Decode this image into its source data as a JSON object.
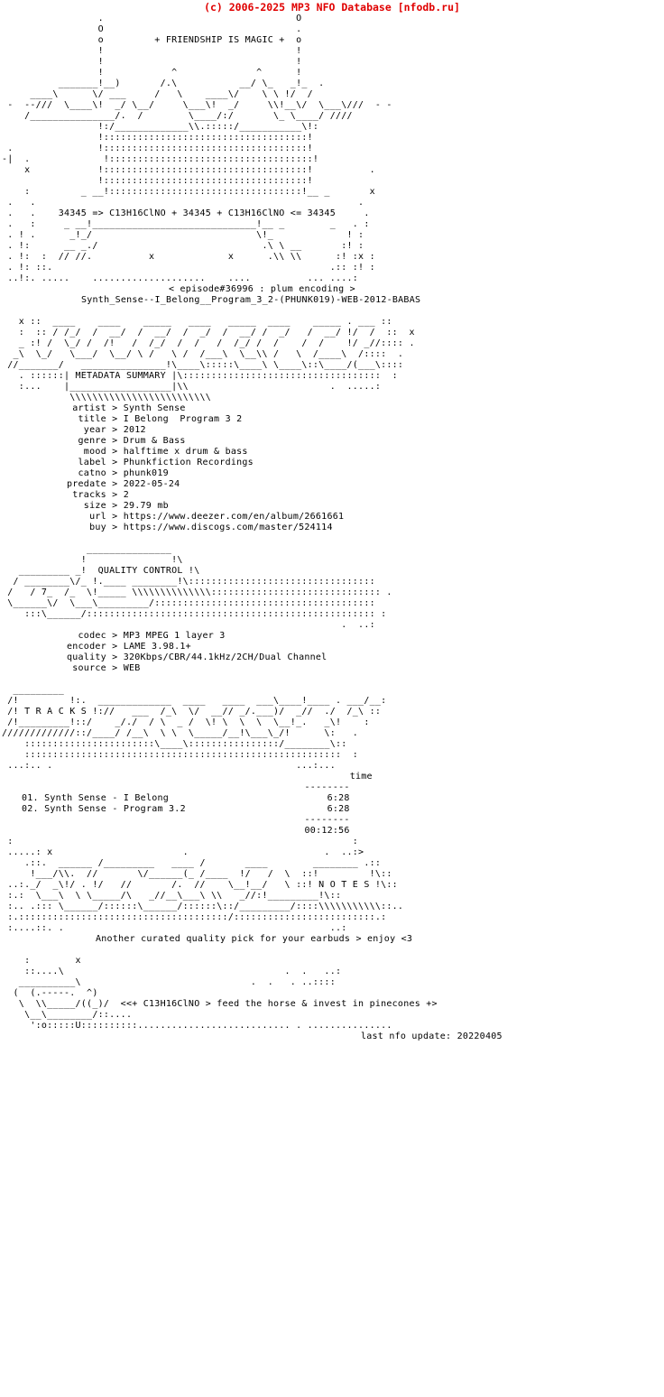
{
  "site_header": "(c) 2006-2025 MP3 NFO Database [nfodb.ru]",
  "accent_color": "#e00000",
  "text_color": "#000000",
  "background_color": "#ffffff",
  "group_tagline": "+ FRIENDSHIP IS MAGIC +",
  "chem_line": "34345 => C13H16ClNO + 34345 + C13H16ClNO <= 34345",
  "episode_line": "< episode#36996 : plum encoding >",
  "release_name": "Synth_Sense--I_Belong__Program_3_2-(PHUNK019)-WEB-2012-BABAS",
  "banners": {
    "metadata": "METADATA SUMMARY",
    "quality": "QUALITY CONTROL",
    "tracks": "T R A C K S",
    "notes": "N O T E S"
  },
  "metadata": {
    "groups": [
      [
        {
          "label": "artist",
          "sep": ">",
          "value": "Synth Sense"
        },
        {
          "label": "title",
          "sep": ">",
          "value": "I Belong  Program 3 2"
        },
        {
          "label": "year",
          "sep": ">",
          "value": "2012"
        },
        {
          "label": "genre",
          "sep": ">",
          "value": "Drum & Bass"
        },
        {
          "label": "mood",
          "sep": ">",
          "value": "halftime x drum & bass"
        }
      ],
      [
        {
          "label": "label",
          "sep": ">",
          "value": "Phunkfiction Recordings"
        },
        {
          "label": "catno",
          "sep": ">",
          "value": "phunk019"
        }
      ],
      [
        {
          "label": "predate",
          "sep": ">",
          "value": "2022-05-24"
        },
        {
          "label": "tracks",
          "sep": ">",
          "value": "2"
        },
        {
          "label": "size",
          "sep": ">",
          "value": "29.79 mb"
        }
      ],
      [
        {
          "label": "url",
          "sep": ">",
          "value": "https://www.deezer.com/en/album/2661661"
        },
        {
          "label": "buy",
          "sep": ">",
          "value": "https://www.discogs.com/master/524114"
        }
      ]
    ]
  },
  "quality": {
    "rows": [
      {
        "label": "codec",
        "sep": ">",
        "value": "MP3 MPEG 1 layer 3"
      },
      {
        "label": "encoder",
        "sep": ">",
        "value": "LAME 3.98.1+"
      },
      {
        "label": "quality",
        "sep": ">",
        "value": "320Kbps/CBR/44.1kHz/2CH/Dual Channel"
      },
      {
        "label": "source",
        "sep": ">",
        "value": "WEB"
      }
    ]
  },
  "tracklist": {
    "time_header": "time",
    "rule": "--------",
    "rows": [
      {
        "num": "01.",
        "title": "Synth Sense - I Belong",
        "time": "6:28"
      },
      {
        "num": "02.",
        "title": "Synth Sense - Program 3.2",
        "time": "6:28"
      }
    ],
    "total": "00:12:56"
  },
  "notes": {
    "text": "Another curated quality pick for your earbuds > enjoy <3"
  },
  "footer": {
    "horse_line": "<<+ C13H16ClNO > feed the horse & invest in pinecones +>",
    "last_update": "last nfo update: 20220405"
  },
  "art": {
    "top_banner": "                 .                                  O\n                 O                                  .\n                 o         + FRIENDSHIP IS MAGIC +  o\n                 !                                  !\n                 !                    ^             !\n           _____!__)   __/.\\        ____)__      ^_ !    .\n      ____\\    \\/.__/ \\/   \\ ____\\   _/ \\ /\\ \\  !_ /_/\n-  --///  \\____\\!  _//  \\____\\!  _/     \\\\ !__/ _/ \\___\\///  -\n    /______________/. /    \\___/:/  \\_ /  \\___\\  /__//// -\n                 !:/______________\\\\.:::::/___________\\!:\n                 !::::::::::::::::::::::::::::::::::::!\n                 !::::::::::::::::::::::::::::::::::::!",
    "mid_block": " .          !::::::::::::::::::::::::::::::::::::!\n-|   .      !:::::::::::::::::::::::::::::::::::::!\n     x      !::::::::::::::::::::::::::::::::::::!          .\n            !::::::::::::::::::::::::::::::::::::!\n     :   _ __!:::::::::::::::::::::::::::::::::::!__ _      x",
    "lower_frame": " .   .    34345 => C13H16ClNO + 34345 + C13H16ClNO <= 34345    .\n .   .     _ __!_______________________________!__ _     .  :\n . !.      _!_/                              \\!_        . ! :\n . !:     __ _./                              .\\ \\ __    :! :\n . !:  : // //.             x            x     .\\\\ \\\\   :! :x :\n . !: ::.                                              .:: :! :\n ..!:. .....   ..........................   ....    ... .....:",
    "metadata_banner": "   x ::  ___    _____    ____   _____  ____  ____    _____  . ___::\n   :  ::/ / /_  /    / /\\\\  \\    \\  \\    \\  \\   \\    \\  \\  !/  //: x\n   _ :!  \\_/  /_ /! /  \\ \\  \\ \\  \\_\\  \\  \\  \\/  /  /  \\  !/ _//::: .\n  _\\   \\_/   \\___/  \\__/_\\/   \\ /__/___\\  \\__\\\\ /  /____\\  /:::::\n //______/    ________________!\\___\\:::::\\____\\ \\__/::\\___/(__\\::::\n   . ::::::| METADATA SUMMARY |\\:::::::::::::::::::::::::::::::::  :\n   :...    |__________________|\\\\                        .  .....:\n            \\\\\\\\\\\\\\\\\\\\\\\\\\\\\\\\\\\\\\",
    "quality_banner": "              ________________\n             !                !\\\n   ________ _!  QUALITY CONTROL !\\::::::::::::::::::::::::::::::\n  / _______\\/_!.____ ________!\\::::::::::::::::::::::::::::::::: .\n /  / 7_ /_  \\!____  \\\\\\\\\\\\\\\\\\\\\\\\\\:::::::::::::::::::::::::::::::::\n \\______\\/  \\____\\_________/::::::::::::::::::::::::::::::::::::: :\n    :::\\_____/::::::::::::::::::::::::::::::::::::::::::::::::::\n                                                          . ..:",
    "tracks_banner": "  ________\n /!        !:.  ____________   ____  ____  ___ \\___!_____. __/__:\n /! T R A C K S !://  ___ /_\\  \\/  __//_/.___)/  _// ./  /_\\::\n /!________!::/   _/./  / \\ _ / \\! \\  \\  \\ \\__!_.  _\\! :\n////////////::/____/ /__\\ \\ \\ \\_____/__!\\___\\_/!     \\:  .\n    ::::::::::::::::::::::\\____\\::::::::::::::::/_______\\::\n   :::::::::::::::::::::::::::::::::::::::::::::::::::::: :\n ...:.. .                                          ...:...",
    "notes_banner": " :                                                         :\n .....: x                      .                      .  ..:>\n    .::. ______/_______  _____/     ___        _______.::\n    .!__/\\\\.//     \\/____(_/____ !/  /  \\ ::!         !\\::\n..:._/  _\\!/. !/  //     /.  //  \\__!__/  \\::! N O T E S !\\::\n:.:  \\___\\ \\ \\_____/\\  _//__\\__\\ \\\\  _//:!_______!\\::\n:.. .::: \\_____/:::::\\_____/:::::\\:/_______/:::\\\\\\\\\\\\\\\\\\\\::..\n:.::::::::::::::::::::::::::::::::::::/::::::::::::::::::::\n:....::. .                                            ..:",
    "footer_art": "  :     x                                          .:\n  ::....\\                                          ::\n  _______\\                            . .   . ..:!!!\n (  (.-----.  _)                                   \n  \\  \\\\____/((_)/ ",
    "horse": "   .\n   :      x\n  ::....\\                                        .:\n   _________\\                                     ::\n  (  (.-----.  ^)                      . .   . ..::::\n   \\  \\\\____/((_)/ "
  }
}
